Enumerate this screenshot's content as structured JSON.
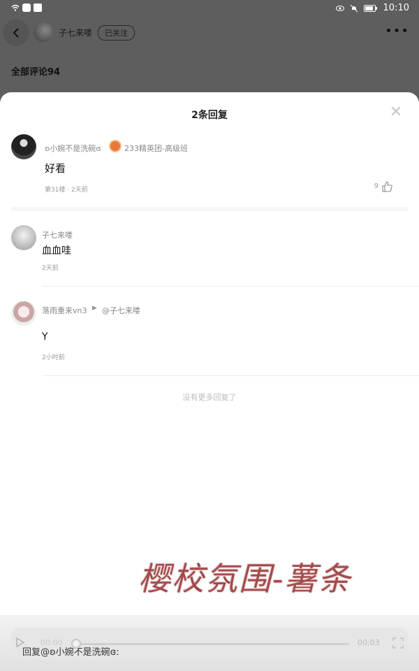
{
  "status_bar": {
    "time": "10:10"
  },
  "background_page": {
    "user_name": "子七来喽",
    "follow_state": "已关注",
    "more": "•••",
    "comments_title": "全部评论94"
  },
  "sheet": {
    "title": "2条回复",
    "close": "✕",
    "main_comment": {
      "user": "ʚ小婉不是洗碗ɞ",
      "badge": "233精英团-高级班",
      "text": "好看",
      "meta": "第31楼 · 2天前",
      "likes": "9"
    },
    "replies": [
      {
        "user": "子七来喽",
        "text": "血血哇",
        "meta": "2天前"
      },
      {
        "user": "落雨重来vn3",
        "reply_to": "@子七来喽",
        "text": "Y",
        "meta": "2小时前"
      }
    ],
    "no_more": "没有更多回复了",
    "watermark": "樱校氛围-薯条"
  },
  "bottom": {
    "reply_placeholder": "回复@ʚ小婉不是洗碗ɞ:",
    "time_current": "00:00",
    "time_total": "00:03",
    "progress": 0
  }
}
